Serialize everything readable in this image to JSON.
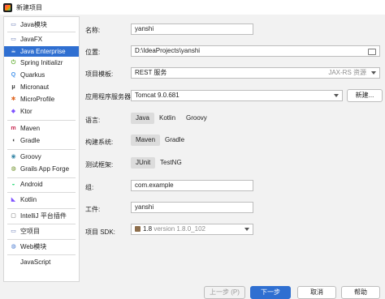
{
  "window": {
    "title": "新建项目"
  },
  "sidebar": {
    "items": [
      {
        "label": "Java模块",
        "icon": "java-module-icon",
        "glyph": "▭",
        "color": "#5a6fae"
      },
      {
        "label": "JavaFX",
        "icon": "javafx-icon",
        "glyph": "▭",
        "color": "#5a6fae"
      },
      {
        "label": "Java Enterprise",
        "icon": "java-enterprise-icon",
        "glyph": "☕",
        "color": "#ffffff"
      },
      {
        "label": "Spring Initializr",
        "icon": "spring-icon",
        "glyph": "⏻",
        "color": "#6db33f"
      },
      {
        "label": "Quarkus",
        "icon": "quarkus-icon",
        "glyph": "Q",
        "color": "#4695eb"
      },
      {
        "label": "Micronaut",
        "icon": "micronaut-icon",
        "glyph": "μ",
        "color": "#333333"
      },
      {
        "label": "MicroProfile",
        "icon": "microprofile-icon",
        "glyph": "✱",
        "color": "#e06c2a"
      },
      {
        "label": "Ktor",
        "icon": "ktor-icon",
        "glyph": "◆",
        "color": "#7f52ff"
      },
      {
        "label": "Maven",
        "icon": "maven-icon",
        "glyph": "m",
        "color": "#c7254e"
      },
      {
        "label": "Gradle",
        "icon": "gradle-icon",
        "glyph": "◖",
        "color": "#333333"
      },
      {
        "label": "Groovy",
        "icon": "groovy-icon",
        "glyph": "◉",
        "color": "#3a89a8"
      },
      {
        "label": "Grails App Forge",
        "icon": "grails-icon",
        "glyph": "◍",
        "color": "#6b8e23"
      },
      {
        "label": "Android",
        "icon": "android-icon",
        "glyph": "◒",
        "color": "#3ddc84"
      },
      {
        "label": "Kotlin",
        "icon": "kotlin-icon",
        "glyph": "◣",
        "color": "#7f52ff"
      },
      {
        "label": "IntelliJ 平台插件",
        "icon": "plugin-icon",
        "glyph": "▢",
        "color": "#666666"
      },
      {
        "label": "空项目",
        "icon": "empty-project-icon",
        "glyph": "▭",
        "color": "#5a6fae"
      },
      {
        "label": "Web模块",
        "icon": "web-module-icon",
        "glyph": "◍",
        "color": "#4a7bd0"
      },
      {
        "label": "JavaScript",
        "icon": "",
        "glyph": "",
        "color": "#333333"
      }
    ],
    "selected_index": 2
  },
  "form": {
    "name": {
      "label": "名称:",
      "value": "yanshi"
    },
    "location": {
      "label": "位置:",
      "value": "D:\\IdeaProjects\\yanshi"
    },
    "template": {
      "label": "项目模板:",
      "value": "REST 服务",
      "hint": "JAX-RS 资源"
    },
    "server": {
      "label": "应用程序服务器:",
      "value": "Tomcat 9.0.681",
      "new_button": "新建..."
    },
    "language": {
      "label": "语言:",
      "options": [
        "Java",
        "Kotlin",
        "Groovy"
      ],
      "selected": "Java"
    },
    "build_system": {
      "label": "构建系统:",
      "options": [
        "Maven",
        "Gradle"
      ],
      "selected": "Maven"
    },
    "test_framework": {
      "label": "测试框架:",
      "options": [
        "JUnit",
        "TestNG"
      ],
      "selected": "JUnit"
    },
    "group": {
      "label": "组:",
      "value": "com.example"
    },
    "artifact": {
      "label": "工件:",
      "value": "yanshi"
    },
    "sdk": {
      "label": "项目 SDK:",
      "value": "1.8",
      "version": "version 1.8.0_102"
    }
  },
  "footer": {
    "previous": "上一步 (P)",
    "next": "下一步",
    "cancel": "取消",
    "help": "帮助"
  },
  "colors": {
    "accent": "#2f6fd1"
  }
}
